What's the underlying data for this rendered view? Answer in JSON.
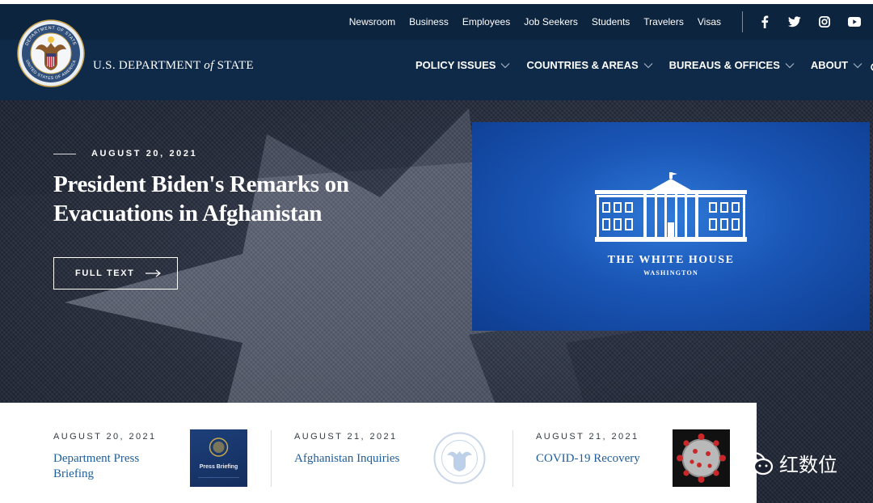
{
  "utility_nav": [
    "Newsroom",
    "Business",
    "Employees",
    "Job Seekers",
    "Students",
    "Travelers",
    "Visas"
  ],
  "social_icons": [
    "facebook-icon",
    "twitter-icon",
    "instagram-icon",
    "youtube-icon"
  ],
  "brand": {
    "pre": "U.S. DEPARTMENT ",
    "of": "of",
    "post": " STATE"
  },
  "seal": {
    "ring_top": "DEPARTMENT OF STATE",
    "ring_bottom": "UNITED STATES OF AMERICA"
  },
  "main_nav": [
    "POLICY ISSUES",
    "COUNTRIES & AREAS",
    "BUREAUS & OFFICES",
    "ABOUT"
  ],
  "hero": {
    "date": "AUGUST 20, 2021",
    "title": "President Biden's Remarks on Evacuations in Afghanistan",
    "button_label": "FULL TEXT"
  },
  "white_house_card": {
    "title": "THE WHITE HOUSE",
    "subtitle": "WASHINGTON"
  },
  "cards": [
    {
      "date": "AUGUST 20, 2021",
      "title": "Department Press Briefing",
      "thumb_label": "Press Briefing"
    },
    {
      "date": "AUGUST 21, 2021",
      "title": "Afghanistan Inquiries"
    },
    {
      "date": "AUGUST 21, 2021",
      "title": "COVID-19 Recovery"
    }
  ],
  "watermark": "红数位",
  "colors": {
    "header": "#0f2a48",
    "utility": "#0d243e",
    "link": "#1f5d98",
    "wh_blue": "#1a56b6"
  }
}
